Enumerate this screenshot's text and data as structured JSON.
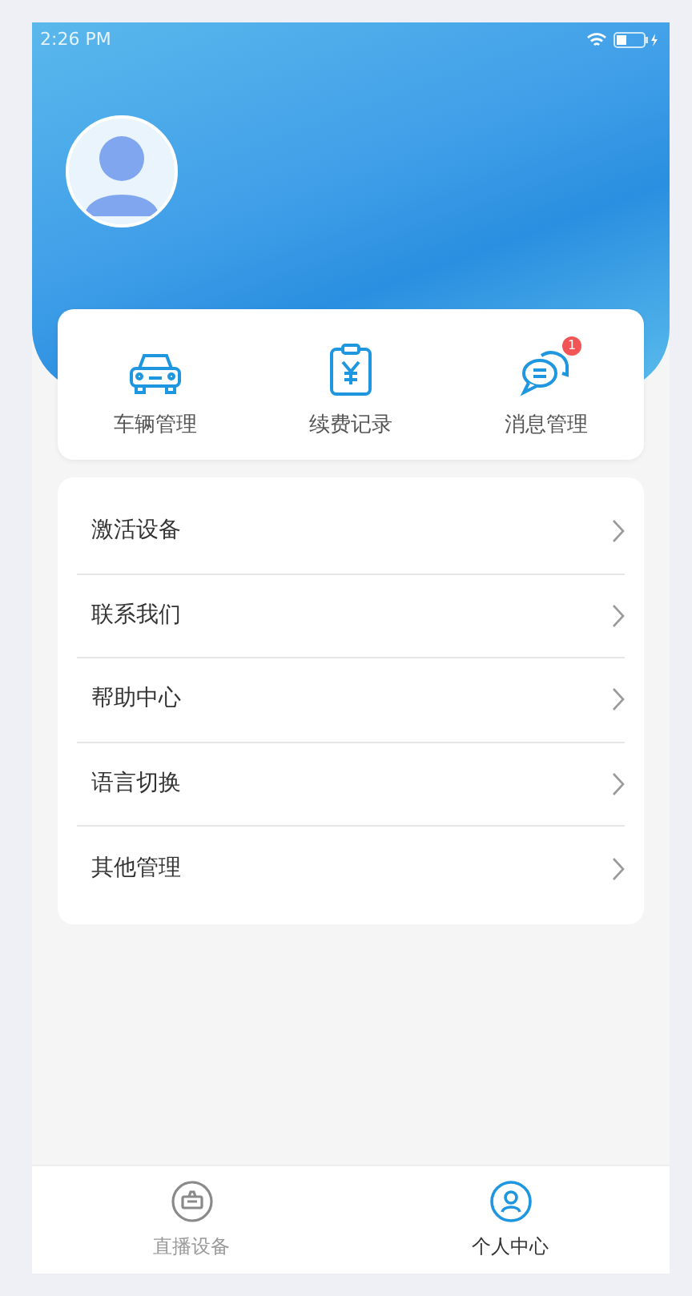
{
  "status_bar": {
    "time": "2:26 PM"
  },
  "shortcuts": [
    {
      "kind": "car",
      "label": "车辆管理"
    },
    {
      "kind": "bill",
      "label": "续费记录"
    },
    {
      "kind": "chat",
      "label": "消息管理",
      "badge": "1"
    }
  ],
  "menu": [
    {
      "label": "激活设备"
    },
    {
      "label": "联系我们"
    },
    {
      "label": "帮助中心"
    },
    {
      "label": "语言切换"
    },
    {
      "label": "其他管理"
    }
  ],
  "tabs": [
    {
      "kind": "device",
      "label": "直播设备",
      "selected": false
    },
    {
      "kind": "person",
      "label": "个人中心",
      "selected": true
    }
  ]
}
